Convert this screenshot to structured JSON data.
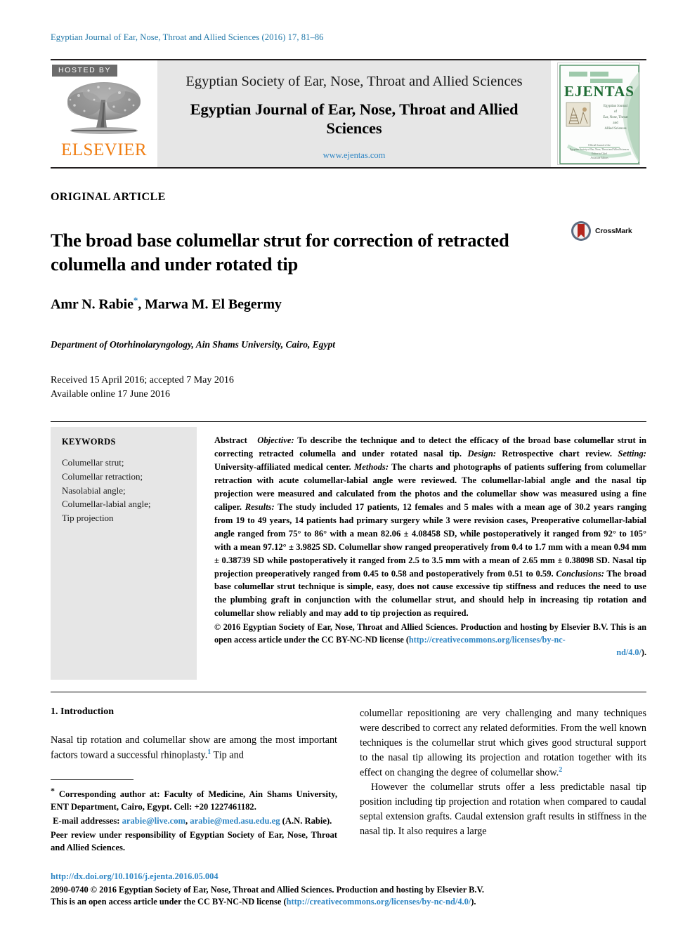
{
  "running_head": "Egyptian Journal of Ear, Nose, Throat and Allied Sciences (2016) 17, 81–86",
  "masthead": {
    "hosted_by_label": "HOSTED BY",
    "publisher_name": "ELSEVIER",
    "society_line": "Egyptian Society of Ear, Nose, Throat and Allied Sciences",
    "journal_title": "Egyptian Journal of Ear, Nose, Throat and Allied Sciences",
    "journal_url": "www.ejentas.com",
    "cover": {
      "title": "EJENTAS",
      "subtitle_lines": [
        "Egyptian Journal",
        "of",
        "Ear, Nose, Throat",
        "and",
        "Allied Sciences"
      ],
      "footer_note": "Official Journal of the Egyptian Society of Ear, Nose, Throat and Allied Sciences"
    }
  },
  "article": {
    "type": "ORIGINAL ARTICLE",
    "title": "The broad base columellar strut for correction of retracted columella and under rotated tip",
    "crossmark_label": "CrossMark",
    "authors": "Amr N. Rabie",
    "corresponding_marker": "*",
    "authors_rest": ", Marwa M. El Begermy",
    "affiliation": "Department of Otorhinolaryngology, Ain Shams University, Cairo, Egypt",
    "received_line": "Received 15 April 2016; accepted 7 May 2016",
    "available_line": "Available online 17 June 2016"
  },
  "keywords": {
    "heading": "KEYWORDS",
    "items": [
      "Columellar strut;",
      "Columellar retraction;",
      "Nasolabial angle;",
      "Columellar-labial angle;",
      "Tip projection"
    ]
  },
  "abstract": {
    "label": "Abstract",
    "objective_label": "Objective:",
    "objective_text": " To describe the technique and to detect the efficacy of the broad base columellar strut in correcting retracted columella and under rotated nasal tip. ",
    "design_label": "Design:",
    "design_text": " Retrospective chart review. ",
    "setting_label": "Setting:",
    "setting_text": " University-affiliated medical center. ",
    "methods_label": "Methods:",
    "methods_text": " The charts and photographs of patients suffering from columellar retraction with acute columellar-labial angle were reviewed. The columellar-labial angle and the nasal tip projection were measured and calculated from the photos and the columellar show was measured using a fine caliper. ",
    "results_label": "Results:",
    "results_text": " The study included 17 patients, 12 females and 5 males with a mean age of 30.2 years ranging from 19 to 49 years, 14 patients had primary surgery while 3 were revision cases, Preoperative columellar-labial angle ranged from 75° to 86° with a mean 82.06 ± 4.08458 SD, while postoperatively it ranged from 92° to 105° with a mean 97.12° ± 3.9825 SD. Columellar show ranged preoperatively from 0.4 to 1.7 mm with a mean 0.94 mm ± 0.38739 SD while postoperatively it ranged from 2.5 to 3.5 mm with a mean of 2.65 mm ± 0.38098 SD. Nasal tip projection preoperatively ranged from 0.45 to 0.58 and postoperatively from 0.51 to 0.59. ",
    "conclusions_label": "Conclusions:",
    "conclusions_text": " The broad base columellar strut technique is simple, easy, does not cause excessive tip stiffness and reduces the need to use the plumbing graft in conjunction with the columellar strut, and should help in increasing tip rotation and columellar show reliably and may add to tip projection as required.",
    "copyright_line": "© 2016 Egyptian Society of Ear, Nose, Throat and Allied Sciences. Production and hosting by Elsevier B.V. This is an open access article under the CC BY-NC-ND license (",
    "license_url_part1": "http://creativecommons.org/licenses/by-nc-",
    "license_url_part2": "nd/4.0/",
    "copyright_close": ")."
  },
  "body": {
    "section_title": "1. Introduction",
    "left_paragraph": "Nasal tip rotation and columellar show are among the most important factors toward a successful rhinoplasty.",
    "left_ref": "1",
    "left_paragraph_tail": " Tip and",
    "right_paragraph_1": "columellar repositioning are very challenging and many techniques were described to correct any related deformities. From the well known techniques is the columellar strut which gives good structural support to the nasal tip allowing its projection and rotation together with its effect on changing the degree of columellar show.",
    "right_ref_1": "2",
    "right_paragraph_2": "However the columellar struts offer a less predictable nasal tip position including tip projection and rotation when compared to caudal septal extension grafts. Caudal extension graft results in stiffness in the nasal tip. It also requires a large"
  },
  "footnotes": {
    "corresponding_marker": "*",
    "corresponding_text": " Corresponding author at: Faculty of Medicine, Ain Shams University, ENT Department, Cairo, Egypt. Cell: +20 1227461182.",
    "email_label": "E-mail addresses:",
    "email_1": "arabie@live.com",
    "email_separator": ", ",
    "email_2": "arabie@med.asu.edu.eg",
    "email_owner": "(A.N. Rabie).",
    "peer_review": "Peer review under responsibility of Egyptian Society of Ear, Nose, Throat and Allied Sciences."
  },
  "footer": {
    "doi": "http://dx.doi.org/10.1016/j.ejenta.2016.05.004",
    "issn_copyright": "2090-0740 © 2016 Egyptian Society of Ear, Nose, Throat and Allied Sciences. Production and hosting by Elsevier B.V.",
    "license_prefix": "This is an open access article under the CC BY-NC-ND license (",
    "license_url": "http://creativecommons.org/licenses/by-nc-nd/4.0/",
    "license_suffix": ")."
  },
  "colors": {
    "link_blue": "#2f86c4",
    "runhead_blue": "#1f77a8",
    "elsevier_orange": "#f07e13",
    "panel_gray": "#e6e6e6",
    "hosted_gray": "#6b6b6b",
    "cover_green": "#2f7d48"
  }
}
